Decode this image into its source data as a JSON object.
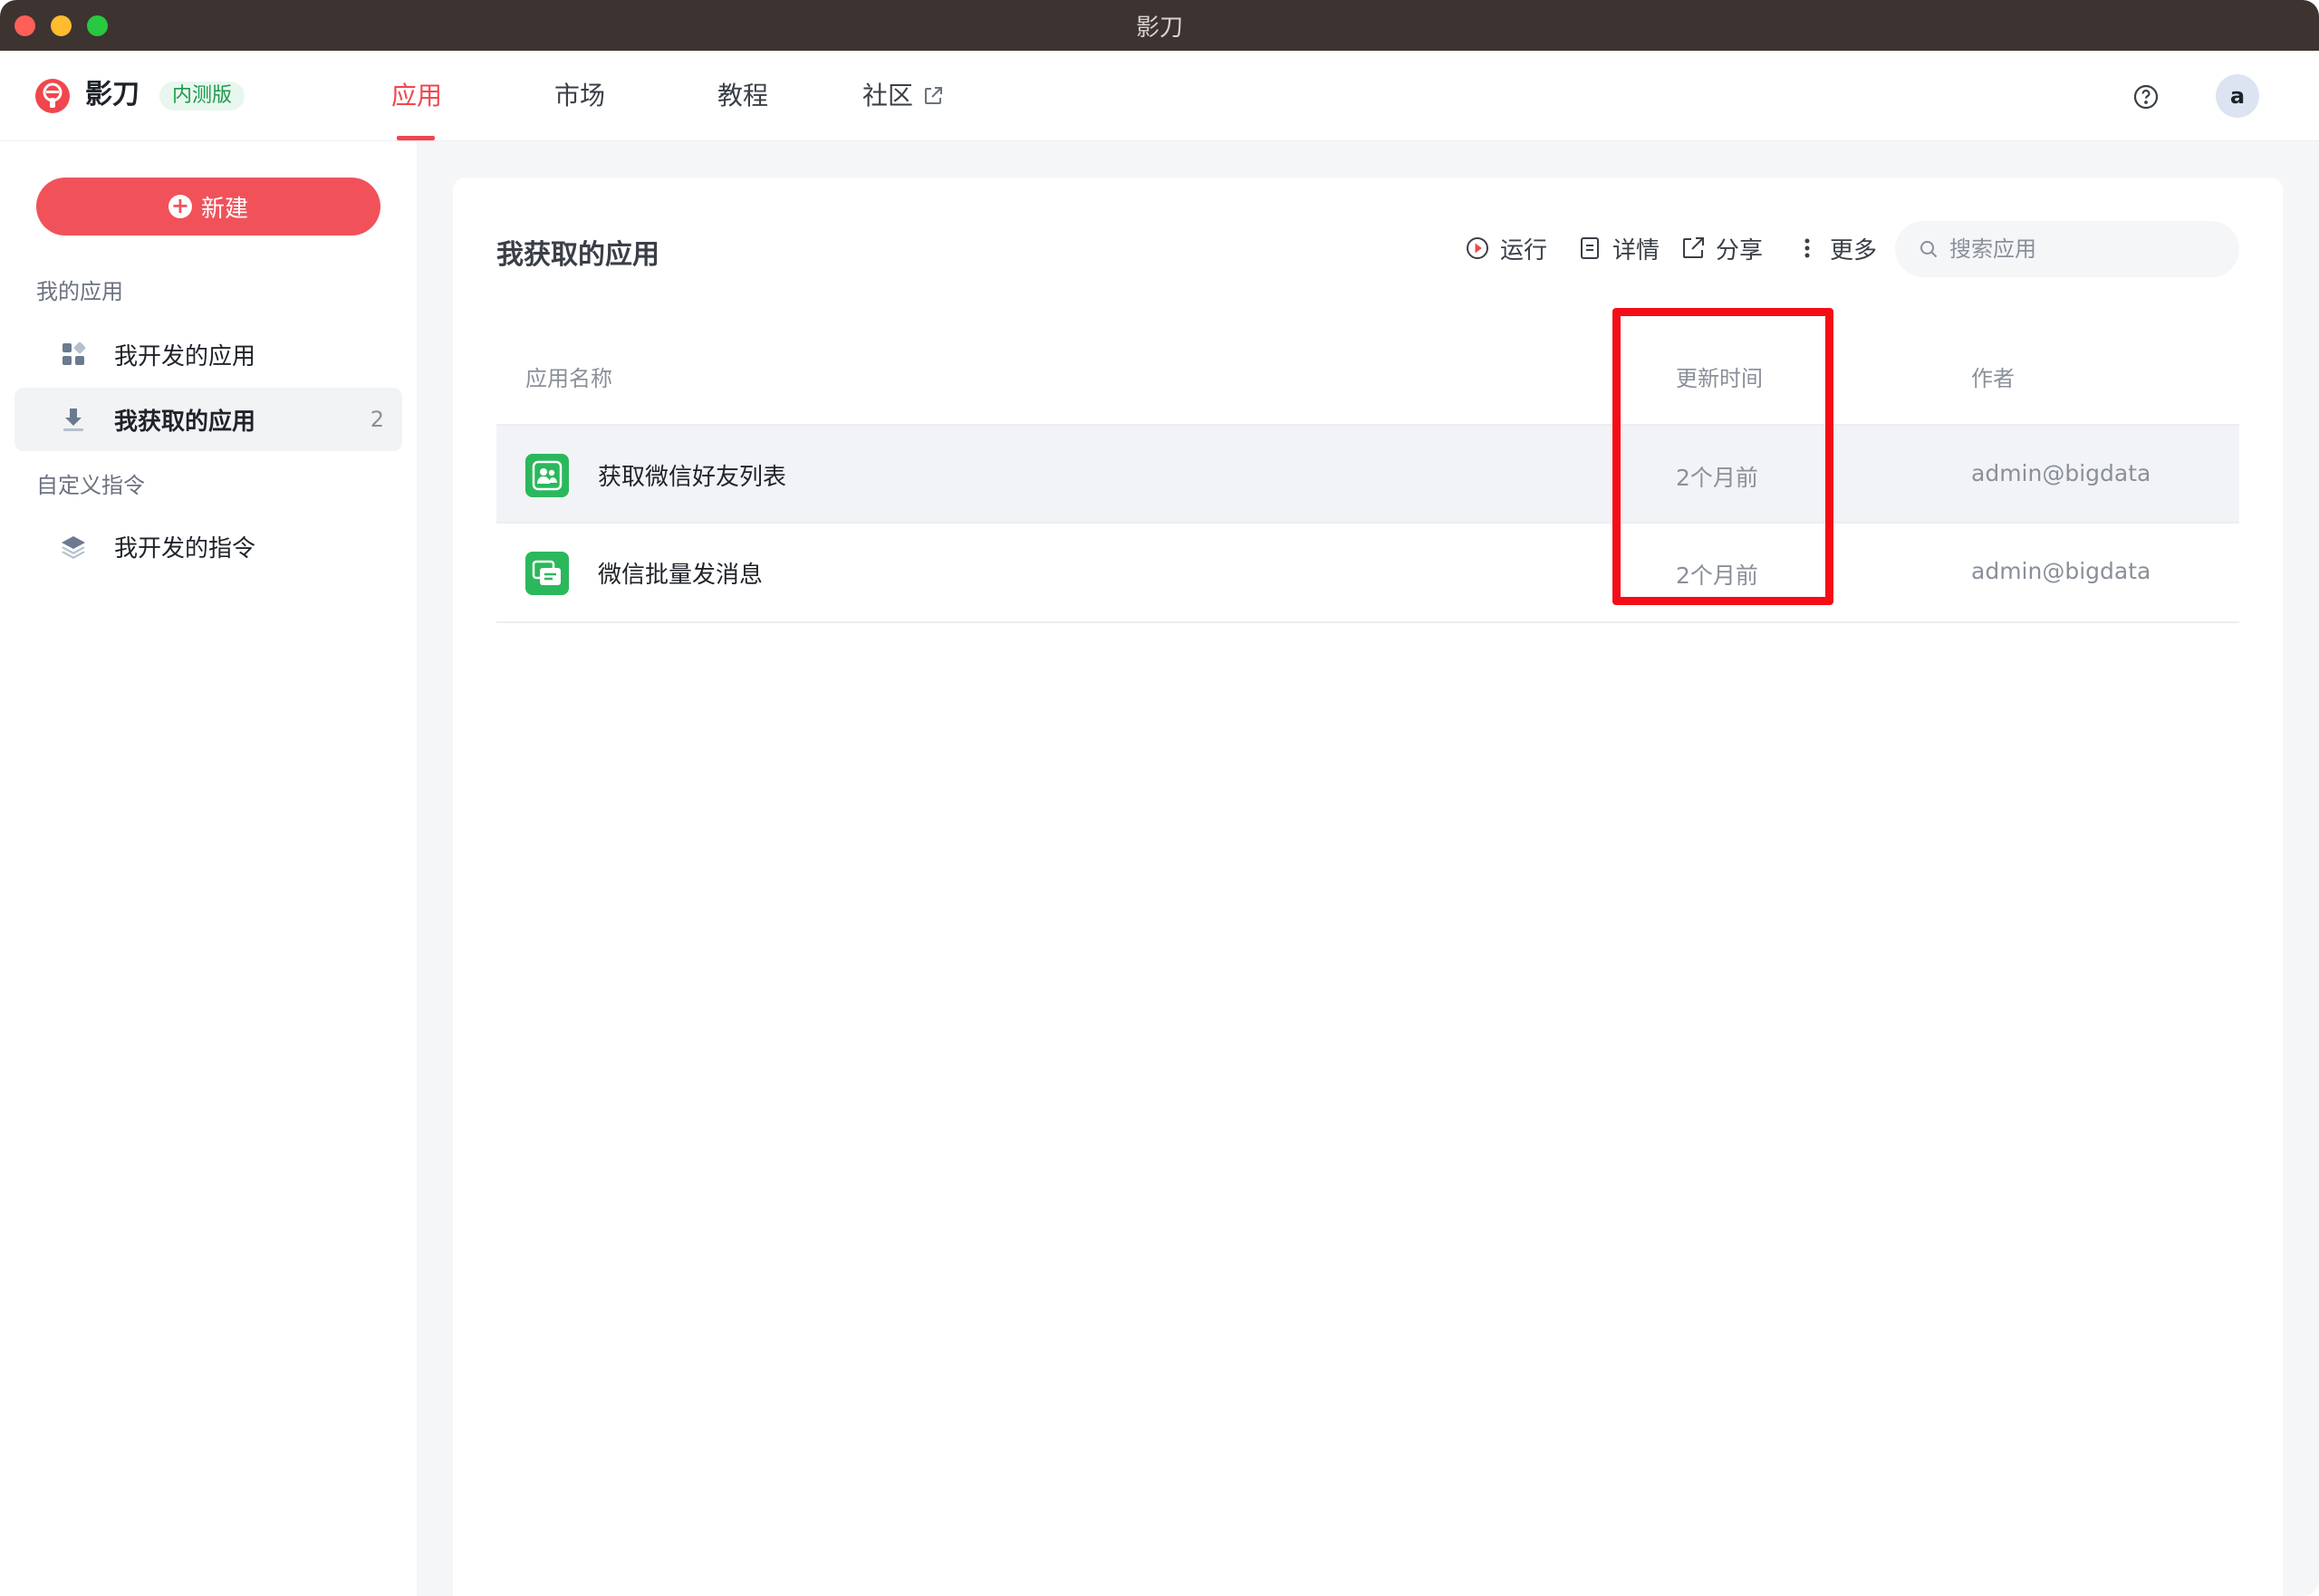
{
  "window": {
    "title": "影刀"
  },
  "topnav": {
    "brand": "影刀",
    "badge": "内测版",
    "tabs": [
      {
        "label": "应用",
        "active": true
      },
      {
        "label": "市场",
        "active": false
      },
      {
        "label": "教程",
        "active": false
      },
      {
        "label": "社区",
        "active": false
      }
    ],
    "avatar_letter": "a"
  },
  "sidebar": {
    "new_label": "新建",
    "sections": [
      {
        "label": "我的应用",
        "items": [
          {
            "label": "我开发的应用",
            "icon": "grid-apps-icon"
          },
          {
            "label": "我获取的应用",
            "icon": "download-icon",
            "count": "2",
            "active": true
          }
        ]
      },
      {
        "label": "自定义指令",
        "items": [
          {
            "label": "我开发的指令",
            "icon": "layers-icon"
          }
        ]
      }
    ]
  },
  "main": {
    "title": "我获取的应用",
    "toolbar": {
      "run": "运行",
      "details": "详情",
      "share": "分享",
      "more": "更多"
    },
    "search_placeholder": "搜索应用",
    "table": {
      "columns": [
        "应用名称",
        "更新时间",
        "作者"
      ],
      "rows": [
        {
          "name": "获取微信好友列表",
          "updated": "2个月前",
          "author": "admin@bigdata"
        },
        {
          "name": "微信批量发消息",
          "updated": "2个月前",
          "author": "admin@bigdata"
        }
      ]
    }
  },
  "colors": {
    "accent": "#f0464e",
    "highlight": "#f40d17",
    "app_icon_green": "#2bb85c"
  }
}
